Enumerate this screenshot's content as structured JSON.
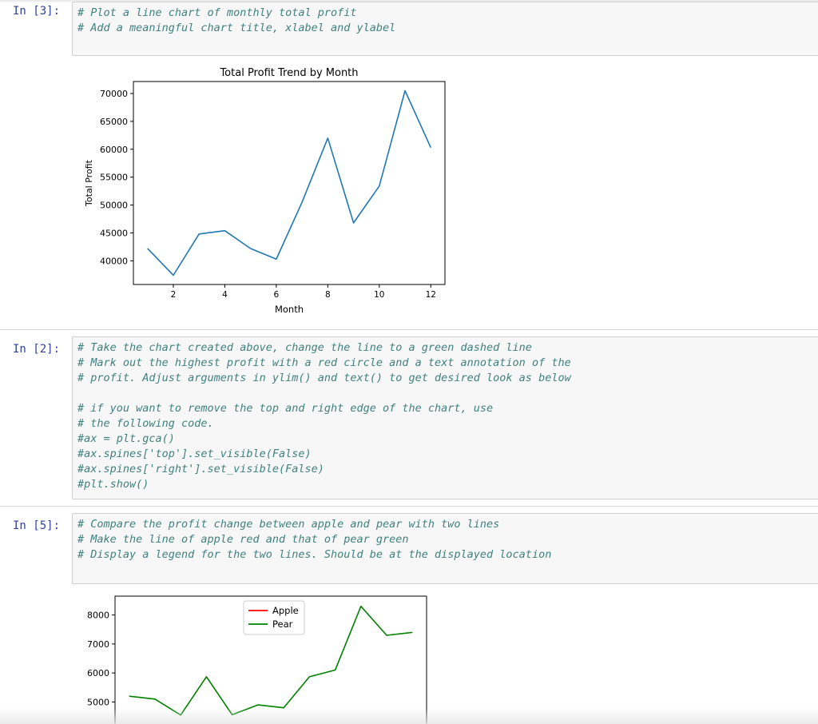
{
  "cells": [
    {
      "prompt": "In [3]:",
      "code": "# Plot a line chart of monthly total profit\n# Add a meaningful chart title, xlabel and ylabel"
    },
    {
      "prompt": "In [2]:",
      "code": "# Take the chart created above, change the line to a green dashed line\n# Mark out the highest profit with a red circle and a text annotation of the\n# profit. Adjust arguments in ylim() and text() to get desired look as below\n\n# if you want to remove the top and right edge of the chart, use\n# the following code.\n#ax = plt.gca()\n#ax.spines['top'].set_visible(False)\n#ax.spines['right'].set_visible(False)\n#plt.show()"
    },
    {
      "prompt": "In [5]:",
      "code": "# Compare the profit change between apple and pear with two lines\n# Make the line of apple red and that of pear green\n# Display a legend for the two lines. Should be at the displayed location"
    }
  ],
  "chart_data": [
    {
      "type": "line",
      "title": "Total Profit Trend by Month",
      "xlabel": "Month",
      "ylabel": "Total Profit",
      "x": [
        1,
        2,
        3,
        4,
        5,
        6,
        7,
        8,
        9,
        10,
        11,
        12
      ],
      "series": [
        {
          "values": [
            42200,
            37400,
            44800,
            45400,
            42200,
            40300,
            50500,
            62000,
            46800,
            53400,
            70500,
            60300
          ],
          "color": "#1f77b4"
        }
      ],
      "xticks": [
        2,
        4,
        6,
        8,
        10,
        12
      ],
      "yticks": [
        40000,
        45000,
        50000,
        55000,
        60000,
        65000,
        70000
      ],
      "xlim": [
        0.45,
        12.55
      ],
      "ylim": [
        35750,
        72150
      ],
      "grid": false
    },
    {
      "type": "line",
      "x": [
        1,
        2,
        3,
        4,
        5,
        6,
        7,
        8,
        9,
        10,
        11,
        12
      ],
      "series": [
        {
          "name": "Apple",
          "values": [],
          "color": "#ff0000"
        },
        {
          "name": "Pear",
          "values": [
            5200,
            5100,
            4550,
            5870,
            4560,
            4900,
            4800,
            5870,
            6100,
            8300,
            7300,
            7400
          ],
          "color": "#008000"
        }
      ],
      "yticks": [
        5000,
        6000,
        7000,
        8000
      ],
      "xlim": [
        0.45,
        12.55
      ],
      "ylim": [
        3800,
        8650
      ],
      "legend": "upper center",
      "grid": false
    }
  ]
}
